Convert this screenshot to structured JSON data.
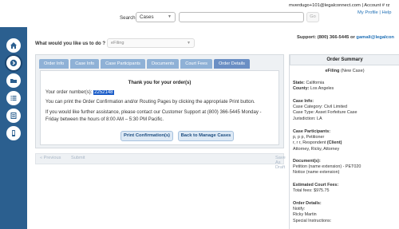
{
  "header": {
    "search_label": "Search:",
    "search_select_value": "Cases",
    "search_input_value": "",
    "go_label": "Go",
    "account_line": "mverdugo+101@legalconnect.com | Account # rz",
    "profile_line": "My Profile | Help"
  },
  "nav": {
    "icons": [
      "home-icon",
      "chevron-right-icon",
      "folder-icon",
      "list-icon",
      "document-icon",
      "mobile-icon"
    ]
  },
  "main": {
    "question": "What would you like us to do ?",
    "action_select_value": "eFiling",
    "support_prefix": "Support: (800) 366-5445 or ",
    "support_email": "gamali@legalcon",
    "tabs": [
      "Order Info",
      "Case Info",
      "Case Participants",
      "Documents",
      "Court Fees",
      "Order Details"
    ],
    "active_tab": "Order Details",
    "thank_you": "Thank you for your order(s)",
    "order_prefix": "Your order number(s): ",
    "order_number": "2252148",
    "print_text": "You can print the Order Confirmation and/or Routing Pages by clicking the appropriate Print button.",
    "assist_text": "If you would like further assistance, please contact our Customer Support at (800) 366-5445 Monday - Friday between the hours of 8:00 AM – 5:30 PM Pacific.",
    "print_confirmation_label": "Print Confirmation(s)",
    "back_to_manage_label": "Back to Manage Cases",
    "previous_label": "« Previous",
    "submit_label": "Submit",
    "save_draft_label": "Save As Draft"
  },
  "summary": {
    "title": "Order Summary",
    "subtitle_bold": "eFiling",
    "subtitle_rest": " (New Case)",
    "state_label": "State:",
    "state_value": " California",
    "county_label": "County:",
    "county_value": " Los Angeles",
    "case_info_label": "Case Info:",
    "case_category": "Case Category: Civil Limited",
    "case_type": "Case Type: Asset Forfeiture Case",
    "jurisdiction": "Jurisdiction: LA",
    "participants_label": "Case Participants:",
    "participant_1": "p, p p, Petitioner",
    "participant_2_prefix": "r, r r, Respondent ",
    "participant_2_client": "(Client)",
    "participant_3": "Attorney, Ricky, Attorney",
    "documents_label": "Document(s):",
    "document_1": "Petition (name extension) - PET020",
    "document_2": "Notice (name extension)",
    "fees_label": "Estimated Court Fees:",
    "fees_value": "Total fees: $975.75",
    "order_details_label": "Order Details:",
    "notify_label": "Notify:",
    "notify_value": "Ricky Martin",
    "special_label": "Special Instructions:"
  }
}
